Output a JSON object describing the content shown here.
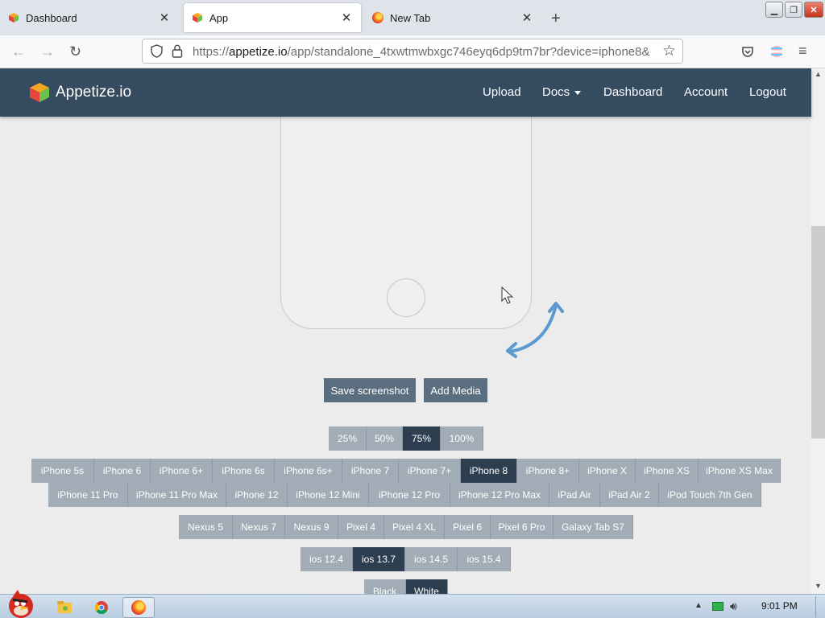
{
  "browser": {
    "tabs": [
      {
        "label": "Dashboard",
        "close": "✕"
      },
      {
        "label": "App",
        "close": "✕"
      },
      {
        "label": "New Tab",
        "close": "✕"
      }
    ],
    "new_tab_glyph": "+",
    "url_domain": "appetize.io",
    "url_prefix": "https://",
    "url_path": "/app/standalone_4txwtmwbxgc746eyq6dp9tm7br?device=iphone8&",
    "nav_icons": [
      "back-arrow-icon",
      "forward-arrow-icon",
      "reload-icon",
      "pocket-icon",
      "account-icon",
      "menu-icon"
    ]
  },
  "app_header": {
    "brand": "Appetize.io",
    "links": {
      "upload": "Upload",
      "docs": "Docs",
      "dashboard": "Dashboard",
      "account": "Account",
      "logout": "Logout"
    }
  },
  "actions": {
    "save_screenshot": "Save screenshot",
    "add_media": "Add Media"
  },
  "zoom": {
    "options": [
      "25%",
      "50%",
      "75%",
      "100%"
    ],
    "selected": "75%"
  },
  "ios_devices_row1": [
    "iPhone 5s",
    "iPhone 6",
    "iPhone 6+",
    "iPhone 6s",
    "iPhone 6s+",
    "iPhone 7",
    "iPhone 7+",
    "iPhone 8",
    "iPhone 8+",
    "iPhone X",
    "iPhone XS",
    "iPhone XS Max"
  ],
  "ios_devices_row2": [
    "iPhone 11 Pro",
    "iPhone 11 Pro Max",
    "iPhone 12",
    "iPhone 12 Mini",
    "iPhone 12 Pro",
    "iPhone 12 Pro Max",
    "iPad Air",
    "iPad Air 2",
    "iPod Touch 7th Gen"
  ],
  "selected_device": "iPhone 8",
  "android_devices": [
    "Nexus 5",
    "Nexus 7",
    "Nexus 9",
    "Pixel 4",
    "Pixel 4 XL",
    "Pixel 6",
    "Pixel 6 Pro",
    "Galaxy Tab S7"
  ],
  "os_versions": {
    "options": [
      "ios 12.4",
      "ios 13.7",
      "ios 14.5",
      "ios 15.4"
    ],
    "selected": "ios 13.7"
  },
  "colors_opt": {
    "options": [
      "Black",
      "White"
    ],
    "selected": "White"
  },
  "taskbar": {
    "clock": "9:01 PM"
  },
  "colors": {
    "header_bg": "#354b60",
    "button_bg": "#5b6e80",
    "segment_bg": "#a2acb6",
    "segment_selected": "#2c3e50"
  }
}
